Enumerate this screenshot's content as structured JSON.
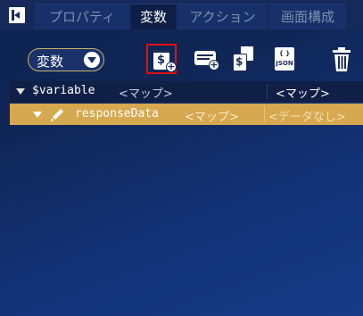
{
  "tabs": [
    {
      "label": "プロパティ",
      "active": false
    },
    {
      "label": "変数",
      "active": true
    },
    {
      "label": "アクション",
      "active": false
    },
    {
      "label": "画面構成",
      "active": false
    }
  ],
  "scope_select": {
    "value": "変数"
  },
  "toolbar": {
    "add_variable_icon": "$",
    "json_icon_braces": "{ }",
    "json_icon_label": "JSON",
    "tools": [
      "add-variable-icon",
      "add-record-icon",
      "copy-variable-icon",
      "json-icon",
      "trash-icon"
    ]
  },
  "tree": {
    "header": {
      "name": "$variable",
      "type": "<マップ>",
      "value": "<マップ>"
    },
    "rows": [
      {
        "name": "responseData",
        "type": "<マップ>",
        "value": "<データなし>",
        "selected": true
      }
    ]
  },
  "colors": {
    "selected_row": "#d6a850",
    "highlight_border": "#e01010",
    "background": "#0f2656"
  }
}
